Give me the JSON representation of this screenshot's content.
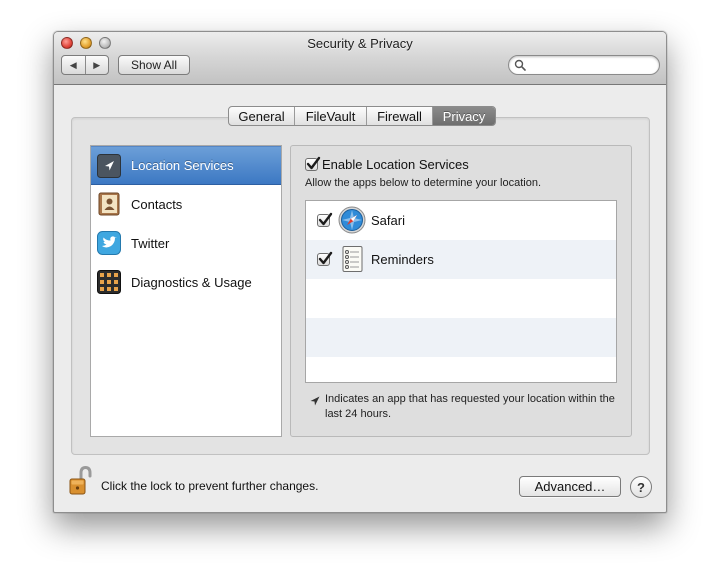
{
  "window": {
    "title": "Security & Privacy"
  },
  "toolbar": {
    "back_glyph": "◀",
    "forward_glyph": "▶",
    "show_all_label": "Show All",
    "search_value": ""
  },
  "tabs": [
    {
      "label": "General",
      "selected": false
    },
    {
      "label": "FileVault",
      "selected": false
    },
    {
      "label": "Firewall",
      "selected": false
    },
    {
      "label": "Privacy",
      "selected": true
    }
  ],
  "sidebar": {
    "items": [
      {
        "label": "Location Services",
        "icon": "location-arrow-icon",
        "selected": true
      },
      {
        "label": "Contacts",
        "icon": "contacts-book-icon",
        "selected": false
      },
      {
        "label": "Twitter",
        "icon": "twitter-bird-icon",
        "selected": false
      },
      {
        "label": "Diagnostics & Usage",
        "icon": "diagnostics-grid-icon",
        "selected": false
      }
    ]
  },
  "location": {
    "enable_label": "Enable Location Services",
    "enabled": true,
    "hint": "Allow the apps below to determine your location.",
    "apps": [
      {
        "label": "Safari",
        "icon": "safari-compass-icon",
        "checked": true
      },
      {
        "label": "Reminders",
        "icon": "reminders-list-icon",
        "checked": true
      }
    ],
    "legend_text": "Indicates an app that has requested your location within the last 24 hours."
  },
  "footer": {
    "lock_text": "Click the lock to prevent further changes.",
    "advanced_label": "Advanced…",
    "help_label": "?"
  },
  "colors": {
    "selection_blue": "#3c78c3",
    "window_bg": "#ececec"
  }
}
